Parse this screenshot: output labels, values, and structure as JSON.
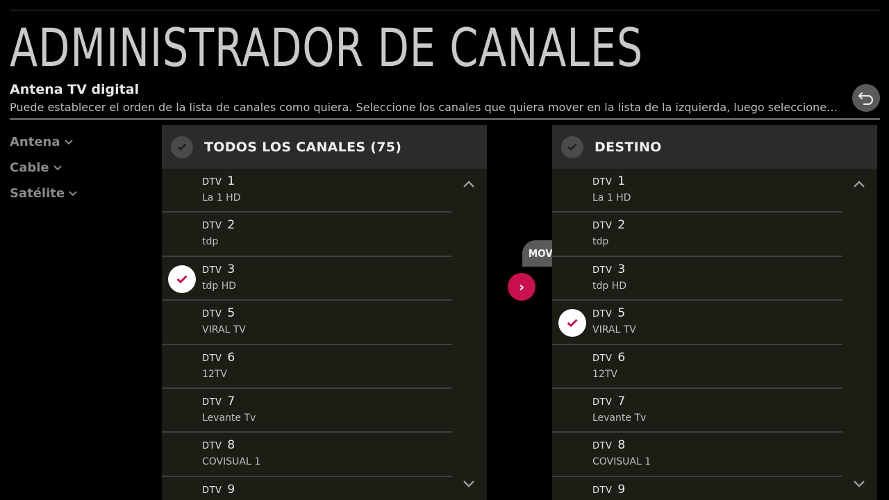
{
  "title": "ADMINISTRADOR DE CANALES",
  "subtitle": "Antena TV digital",
  "description": "Puede establecer el orden de la lista de canales como quiera. Seleccione los canales que quiera mover en la lista de la izquierda, luego seleccione un o...",
  "sidebar": {
    "items": [
      {
        "label": "Antena"
      },
      {
        "label": "Cable"
      },
      {
        "label": "Satélite"
      }
    ]
  },
  "left_panel": {
    "title": "TODOS LOS CANALES (75)",
    "channels": [
      {
        "type": "DTV",
        "number": "1",
        "name": "La 1 HD",
        "selected": false
      },
      {
        "type": "DTV",
        "number": "2",
        "name": "tdp",
        "selected": false
      },
      {
        "type": "DTV",
        "number": "3",
        "name": "tdp HD",
        "selected": true
      },
      {
        "type": "DTV",
        "number": "5",
        "name": "VIRAL TV",
        "selected": false
      },
      {
        "type": "DTV",
        "number": "6",
        "name": "12TV",
        "selected": false
      },
      {
        "type": "DTV",
        "number": "7",
        "name": "Levante Tv",
        "selected": false
      },
      {
        "type": "DTV",
        "number": "8",
        "name": "COVISUAL 1",
        "selected": false
      },
      {
        "type": "DTV",
        "number": "9",
        "name": "",
        "selected": false
      }
    ]
  },
  "right_panel": {
    "title": "DESTINO",
    "channels": [
      {
        "type": "DTV",
        "number": "1",
        "name": "La 1 HD",
        "selected": false
      },
      {
        "type": "DTV",
        "number": "2",
        "name": "tdp",
        "selected": false
      },
      {
        "type": "DTV",
        "number": "3",
        "name": "tdp HD",
        "selected": false
      },
      {
        "type": "DTV",
        "number": "5",
        "name": "VIRAL TV",
        "selected": true
      },
      {
        "type": "DTV",
        "number": "6",
        "name": "12TV",
        "selected": false
      },
      {
        "type": "DTV",
        "number": "7",
        "name": "Levante Tv",
        "selected": false
      },
      {
        "type": "DTV",
        "number": "8",
        "name": "COVISUAL 1",
        "selected": false
      },
      {
        "type": "DTV",
        "number": "9",
        "name": "",
        "selected": false
      }
    ]
  },
  "move": {
    "label": "MOVER",
    "arrow": "›"
  },
  "colors": {
    "accent": "#c9104f",
    "panel_bg": "#1d1c15",
    "header_bg": "#2b2b2b"
  },
  "icons": {
    "back": "back-arrow-icon",
    "check": "check-icon",
    "chevron_down": "chevron-down-icon",
    "chevron_up": "chevron-up-icon"
  }
}
